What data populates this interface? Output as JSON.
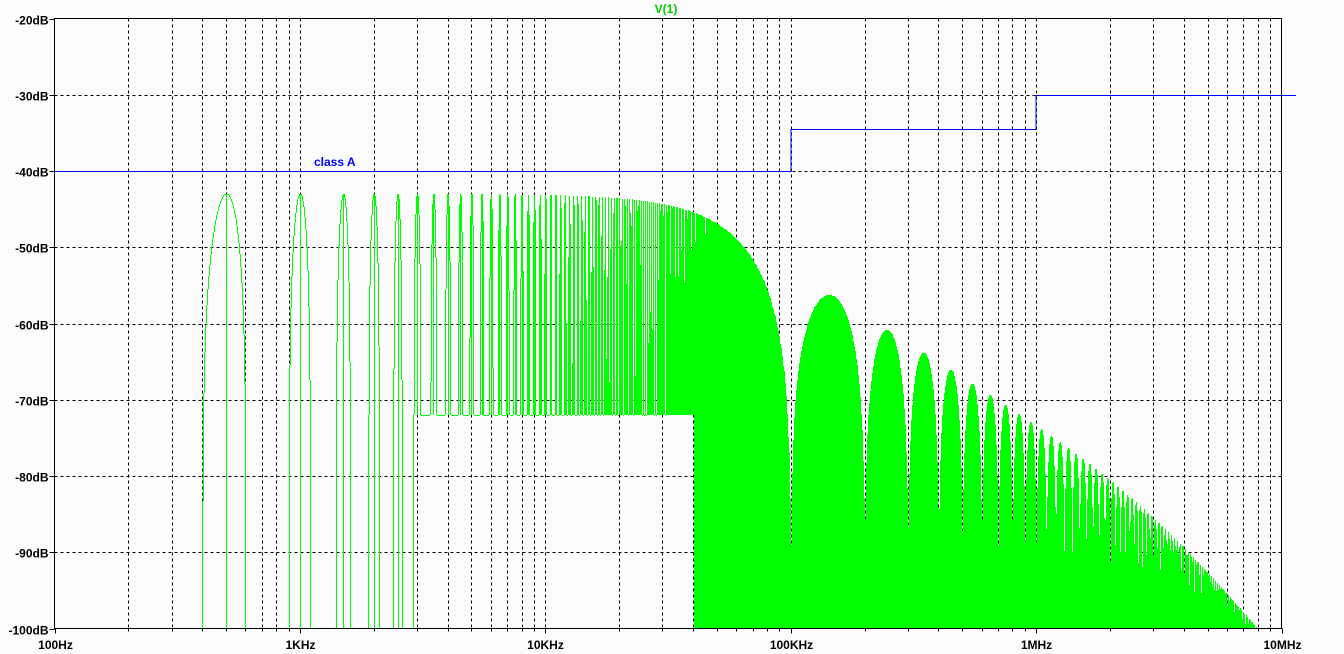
{
  "chart_data": {
    "type": "line",
    "title": "V(1)",
    "xlabel": "",
    "ylabel": "",
    "x_scale": "log",
    "xlim": [
      100,
      10000000
    ],
    "ylim": [
      -100,
      -20
    ],
    "grid": true,
    "x_ticks": [
      {
        "value": 100,
        "label": "100Hz"
      },
      {
        "value": 1000,
        "label": "1KHz"
      },
      {
        "value": 10000,
        "label": "10KHz"
      },
      {
        "value": 100000,
        "label": "100KHz"
      },
      {
        "value": 1000000,
        "label": "1MHz"
      },
      {
        "value": 10000000,
        "label": "10MHz"
      }
    ],
    "y_ticks": [
      {
        "value": -20,
        "label": "-20dB"
      },
      {
        "value": -30,
        "label": "-30dB"
      },
      {
        "value": -40,
        "label": "-40dB"
      },
      {
        "value": -50,
        "label": "-50dB"
      },
      {
        "value": -60,
        "label": "-60dB"
      },
      {
        "value": -70,
        "label": "-70dB"
      },
      {
        "value": -80,
        "label": "-80dB"
      },
      {
        "value": -90,
        "label": "-90dB"
      },
      {
        "value": -100,
        "label": "-100dB"
      }
    ],
    "series": [
      {
        "name": "V(1)",
        "color": "#00ff00",
        "kind": "harmonic-spectrum",
        "fundamental_hz": 500,
        "peak_db": -43,
        "sinc_first_null_hz": 100000,
        "extra_pole_hz": 3000000,
        "inter_harmonic_floor_db": -72
      },
      {
        "name": "class A",
        "color": "#0000ff",
        "label": "class A",
        "points": [
          [
            100,
            -40
          ],
          [
            100000,
            -40
          ],
          [
            100000,
            -34.5
          ],
          [
            1000000,
            -34.5
          ],
          [
            1000000,
            -30
          ],
          [
            11500000,
            -30
          ]
        ]
      }
    ]
  }
}
